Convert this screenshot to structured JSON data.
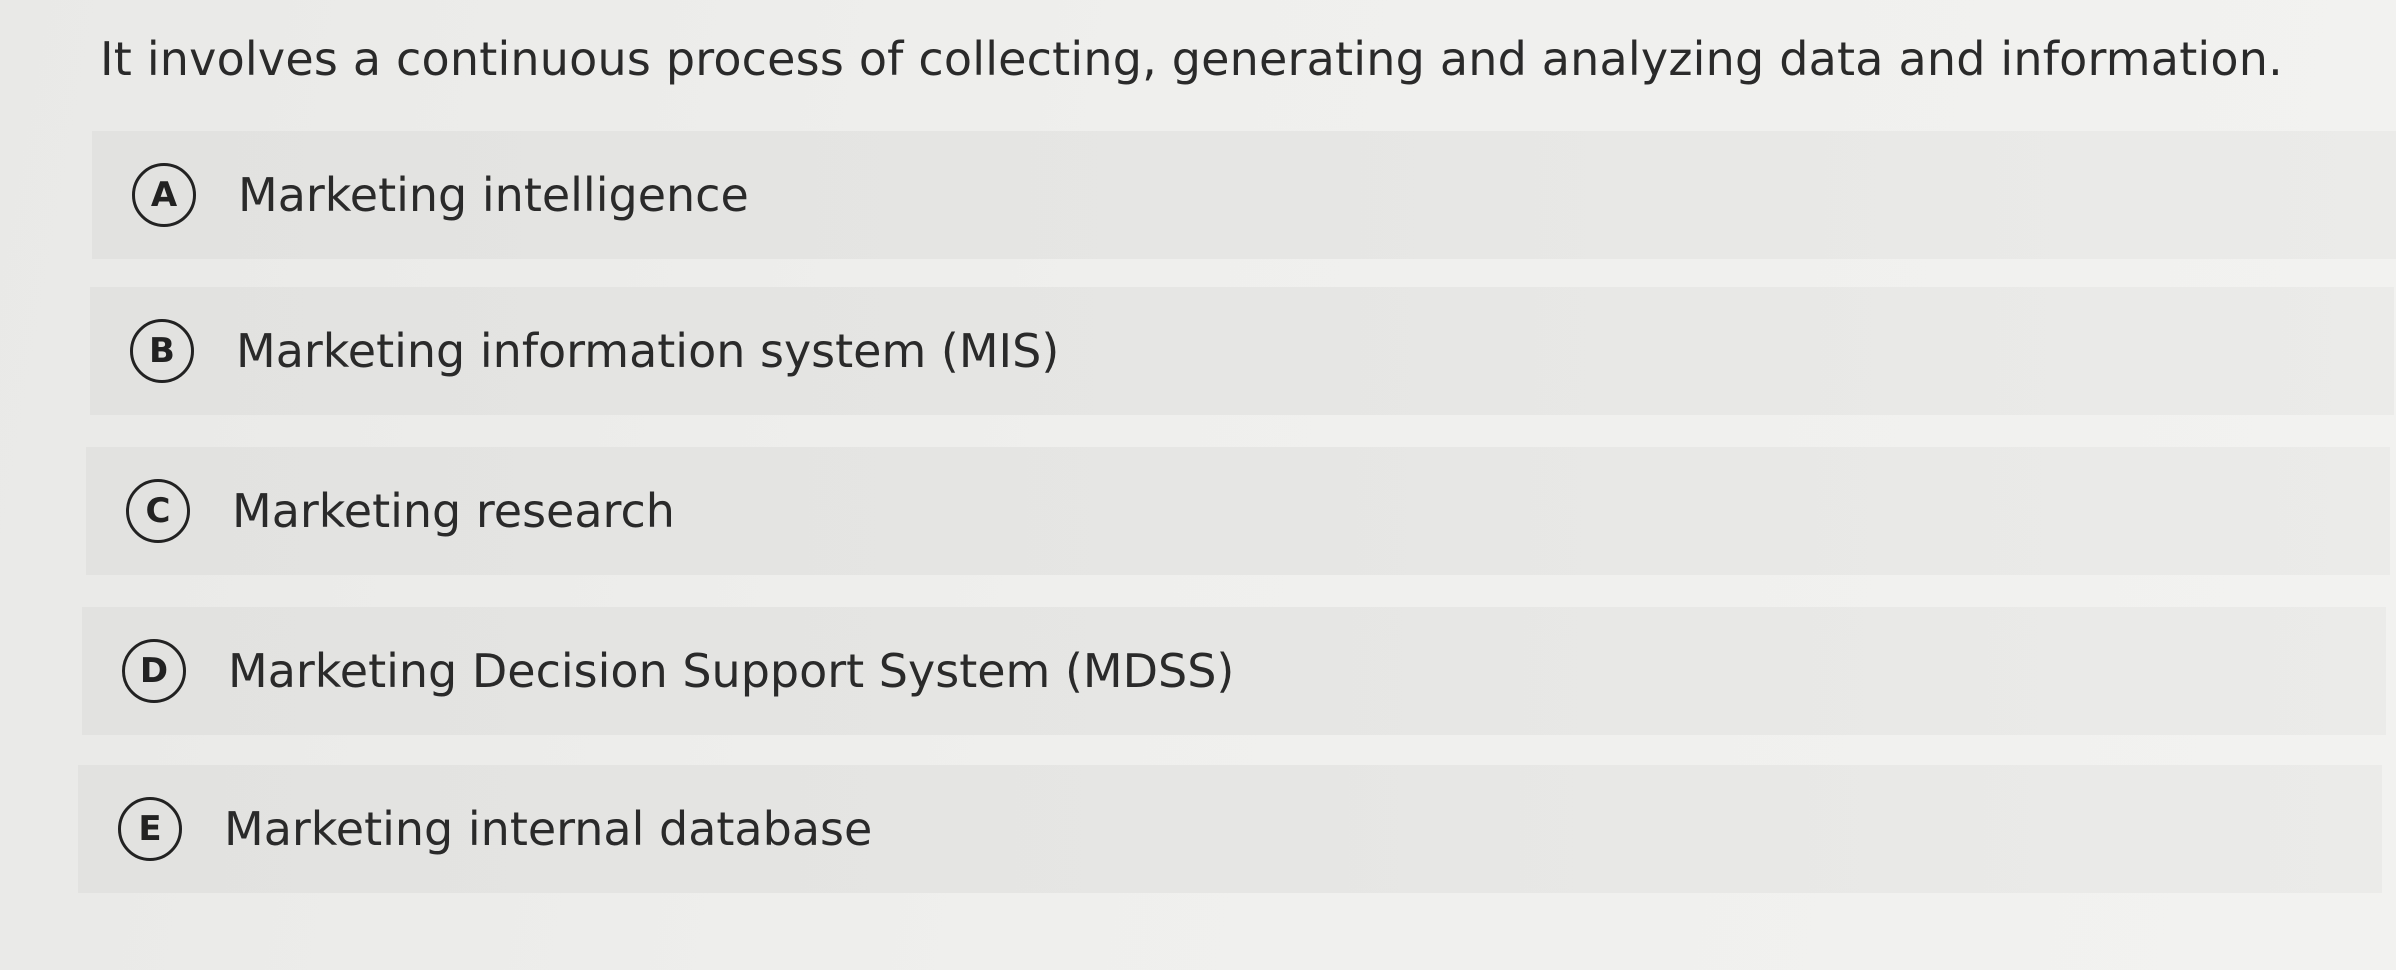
{
  "question": {
    "text": "It involves a continuous process of collecting, generating and analyzing data and information."
  },
  "options": [
    {
      "letter": "A",
      "label": "Marketing intelligence"
    },
    {
      "letter": "B",
      "label": "Marketing information system (MIS)"
    },
    {
      "letter": "C",
      "label": "Marketing research"
    },
    {
      "letter": "D",
      "label": "Marketing Decision Support System (MDSS)"
    },
    {
      "letter": "E",
      "label": "Marketing internal database"
    }
  ]
}
